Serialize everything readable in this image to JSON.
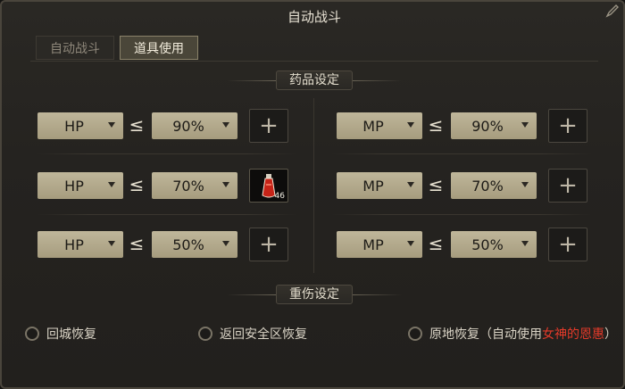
{
  "window": {
    "title": "自动战斗"
  },
  "tabs": [
    {
      "label": "自动战斗",
      "active": false
    },
    {
      "label": "道具使用",
      "active": true
    }
  ],
  "potion_section": {
    "title": "药品设定"
  },
  "hp_rows": [
    {
      "stat": "HP",
      "op": "≤",
      "threshold": "90%",
      "slot": "empty"
    },
    {
      "stat": "HP",
      "op": "≤",
      "threshold": "70%",
      "slot": "red-potion",
      "count": "46"
    },
    {
      "stat": "HP",
      "op": "≤",
      "threshold": "50%",
      "slot": "empty"
    }
  ],
  "mp_rows": [
    {
      "stat": "MP",
      "op": "≤",
      "threshold": "90%",
      "slot": "empty"
    },
    {
      "stat": "MP",
      "op": "≤",
      "threshold": "70%",
      "slot": "empty"
    },
    {
      "stat": "MP",
      "op": "≤",
      "threshold": "50%",
      "slot": "empty"
    }
  ],
  "slot_empty_glyph": "+",
  "injury_section": {
    "title": "重伤设定"
  },
  "revive_options": [
    {
      "label": "回城恢复",
      "selected": false
    },
    {
      "label": "返回安全区恢复",
      "selected": false
    },
    {
      "label_prefix": "原地恢复（自动使用",
      "label_highlight": "女神的恩惠",
      "label_suffix": "）",
      "selected": false
    }
  ],
  "colors": {
    "highlight": "#e43a2a",
    "select_bg": "#b5ab8e",
    "panel_bg": "#252320"
  }
}
